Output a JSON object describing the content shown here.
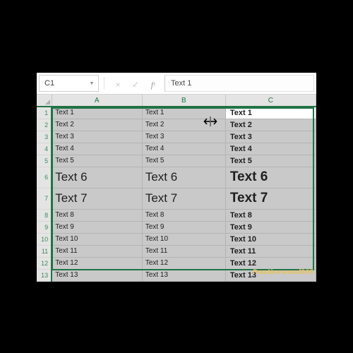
{
  "app": {
    "name": "excel-spreadsheet",
    "accent_color": "#217346",
    "selection_fill": "#c9c9c9",
    "header_fill": "#e4e4e4",
    "watermark_color": "#e8c15a"
  },
  "formula_bar": {
    "name_box_value": "C1",
    "name_box_arrow": "▼",
    "cancel_icon": "×",
    "confirm_icon": "✓",
    "function_icon": "fx",
    "formula_value": "Text 1",
    "formula_placeholder": ""
  },
  "grid": {
    "corner_icon": "select-all-triangle",
    "columns": [
      "A",
      "B",
      "C"
    ],
    "row_numbers": [
      "1",
      "2",
      "3",
      "4",
      "5",
      "6",
      "7",
      "8",
      "9",
      "10",
      "11",
      "12",
      "13"
    ],
    "rows": [
      {
        "num": "1",
        "a": "Text 1",
        "b": "Text 1",
        "c": "Text 1",
        "big": false,
        "active_c": true
      },
      {
        "num": "2",
        "a": "Text 2",
        "b": "Text 2",
        "c": "Text 2",
        "big": false,
        "active_c": false
      },
      {
        "num": "3",
        "a": "Text 3",
        "b": "Text 3",
        "c": "Text 3",
        "big": false,
        "active_c": false
      },
      {
        "num": "4",
        "a": "Text 4",
        "b": "Text 4",
        "c": "Text 4",
        "big": false,
        "active_c": false
      },
      {
        "num": "5",
        "a": "Text 5",
        "b": "Text 5",
        "c": "Text 5",
        "big": false,
        "active_c": false
      },
      {
        "num": "6",
        "a": "Text 6",
        "b": "Text 6",
        "c": "Text 6",
        "big": true,
        "active_c": false
      },
      {
        "num": "7",
        "a": "Text 7",
        "b": "Text 7",
        "c": "Text 7",
        "big": true,
        "active_c": false
      },
      {
        "num": "8",
        "a": "Text 8",
        "b": "Text 8",
        "c": "Text 8",
        "big": false,
        "active_c": false
      },
      {
        "num": "9",
        "a": "Text 9",
        "b": "Text 9",
        "c": "Text 9",
        "big": false,
        "active_c": false
      },
      {
        "num": "10",
        "a": "Text 10",
        "b": "Text 10",
        "c": "Text 10",
        "big": false,
        "active_c": false
      },
      {
        "num": "11",
        "a": "Text 11",
        "b": "Text 11",
        "c": "Text 11",
        "big": false,
        "active_c": false
      },
      {
        "num": "12",
        "a": "Text 12",
        "b": "Text 12",
        "c": "Text 12",
        "big": false,
        "active_c": false
      },
      {
        "num": "13",
        "a": "Text 13",
        "b": "Text 13",
        "c": "Text 13",
        "big": false,
        "active_c": false
      }
    ]
  },
  "cursor": {
    "type": "column-resize-cursor",
    "between_columns": "B|C"
  },
  "watermark": {
    "text": "Practice-excel365"
  }
}
